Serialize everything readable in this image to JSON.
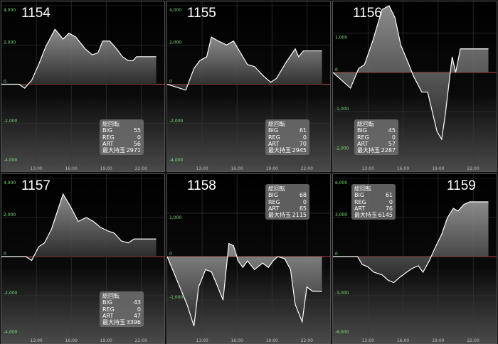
{
  "colors": {
    "line": "#ffffff",
    "zero_line": "#c23b3b",
    "grid": "#3a3a3a",
    "ytick": "#7be07b",
    "xtick": "#bbbbbb"
  },
  "stats_labels": {
    "title": "総回転",
    "big": "BIG",
    "reg": "REG",
    "art": "ART",
    "max": "最大持玉"
  },
  "chart_data": [
    {
      "type": "area",
      "machine": "1154",
      "yticks": [
        4000,
        2000,
        0,
        -2000,
        -4000
      ],
      "ytick_labels": [
        "4,000",
        "2,000",
        "0",
        "-2,000",
        "-4,000"
      ],
      "ylim": [
        -4000,
        4000
      ],
      "xlim": [
        10,
        24
      ],
      "xticks": [
        13,
        16,
        19,
        22
      ],
      "xtick_labels": [
        "13:00",
        "16:00",
        "19:00",
        "22:00"
      ],
      "stats": {
        "big": "55",
        "reg": "0",
        "art": "56",
        "max": "2971"
      },
      "x": [
        10,
        11.5,
        12,
        12.6,
        13.2,
        13.8,
        14.6,
        15.3,
        15.8,
        16.4,
        17.2,
        17.8,
        18.3,
        18.7,
        19.3,
        19.9,
        20.4,
        20.9,
        21.3,
        21.6,
        22.5,
        23.3
      ],
      "y": [
        0,
        0,
        -200,
        200,
        1000,
        1900,
        2800,
        2300,
        2600,
        2400,
        1800,
        1500,
        1600,
        2200,
        2200,
        1800,
        1400,
        1200,
        1200,
        1400,
        1400,
        1400
      ]
    },
    {
      "type": "area",
      "machine": "1155",
      "yticks": [
        4000,
        2000,
        0,
        -2000,
        -4000
      ],
      "ytick_labels": [
        "4,000",
        "2,000",
        "0",
        "-2,000",
        "-4,000"
      ],
      "ylim": [
        -4000,
        4000
      ],
      "xlim": [
        10,
        24
      ],
      "xticks": [
        13,
        16,
        19,
        22
      ],
      "xtick_labels": [
        "13:00",
        "16:00",
        "19:00",
        "22:00"
      ],
      "stats": {
        "big": "61",
        "reg": "0",
        "art": "70",
        "max": "2945"
      },
      "x": [
        10,
        11.6,
        12.3,
        12.8,
        13.4,
        13.8,
        14.4,
        15.1,
        15.7,
        16.4,
        16.9,
        17.5,
        18.3,
        18.9,
        19.4,
        20.2,
        21,
        21.3,
        21.7,
        22.4,
        23.3
      ],
      "y": [
        0,
        -300,
        800,
        1200,
        1400,
        2400,
        2200,
        2000,
        2200,
        1500,
        1000,
        900,
        400,
        100,
        300,
        1100,
        1800,
        1400,
        1700,
        1700,
        1700
      ]
    },
    {
      "type": "area",
      "machine": "1156",
      "yticks": [
        1000,
        0,
        -1000,
        -2000
      ],
      "ytick_labels": [
        "1,000",
        "0",
        "-1,000",
        "-2,000"
      ],
      "ylim": [
        -2300,
        1700
      ],
      "xlim": [
        10,
        24
      ],
      "xticks": [
        13,
        16,
        19,
        22
      ],
      "xtick_labels": [
        "13:00",
        "16:00",
        "19:00",
        "22:00"
      ],
      "stats": {
        "big": "45",
        "reg": "0",
        "art": "57",
        "max": "2287"
      },
      "x": [
        10,
        11.5,
        12.2,
        12.7,
        13.4,
        13.9,
        14.2,
        14.8,
        15.3,
        15.8,
        16.5,
        16.9,
        17.6,
        18.1,
        18.5,
        18.9,
        19.3,
        19.6,
        20.2,
        20.5,
        20.9,
        21.5,
        22.3,
        23.3
      ],
      "y": [
        0,
        -400,
        100,
        200,
        800,
        1300,
        1600,
        1700,
        1400,
        700,
        200,
        -100,
        -500,
        -500,
        -1000,
        -1500,
        -1700,
        -1100,
        400,
        0,
        600,
        600,
        600,
        600
      ]
    },
    {
      "type": "area",
      "machine": "1157",
      "yticks": [
        4000,
        2000,
        0,
        -2000,
        -4000
      ],
      "ytick_labels": [
        "4,000",
        "2,000",
        "0",
        "-2,000",
        "-4,000"
      ],
      "ylim": [
        -4000,
        4000
      ],
      "xlim": [
        10,
        24
      ],
      "xticks": [
        13,
        16,
        19,
        22
      ],
      "xtick_labels": [
        "13:00",
        "16:00",
        "19:00",
        "22:00"
      ],
      "stats": {
        "big": "43",
        "reg": "0",
        "art": "47",
        "max": "3396"
      },
      "x": [
        10,
        11.6,
        12.1,
        12.6,
        13.2,
        13.7,
        14.3,
        14.8,
        15.3,
        15.9,
        16.6,
        17.3,
        17.9,
        18.5,
        19.2,
        19.7,
        20.3,
        20.9,
        21.4,
        21.8,
        22.5,
        23.3
      ],
      "y": [
        0,
        0,
        0,
        -200,
        500,
        700,
        1400,
        2300,
        3200,
        2600,
        1800,
        2000,
        1800,
        1500,
        1300,
        1200,
        800,
        700,
        900,
        900,
        900,
        900
      ]
    },
    {
      "type": "area",
      "machine": "1158",
      "yticks": [
        1000,
        0,
        -1000
      ],
      "ytick_labels": [
        "1,000",
        "0",
        "-1,000"
      ],
      "ylim": [
        -1800,
        1800
      ],
      "xlim": [
        10,
        24
      ],
      "xticks": [
        13,
        16,
        19,
        22
      ],
      "xtick_labels": [
        "13:00",
        "16:00",
        "19:00",
        "22:00"
      ],
      "stats": {
        "big": "68",
        "reg": "0",
        "art": "65",
        "max": "2115"
      },
      "x": [
        10,
        11.7,
        12.3,
        12.7,
        13.3,
        13.8,
        14.2,
        14.8,
        15.3,
        15.7,
        16.1,
        16.5,
        16.9,
        17.5,
        18.2,
        18.7,
        19.1,
        19.5,
        20.1,
        20.6,
        21,
        21.6,
        22,
        22.5,
        23.3
      ],
      "y": [
        0,
        -1100,
        -1600,
        -700,
        -300,
        -350,
        -600,
        -1000,
        300,
        250,
        -100,
        -250,
        -100,
        -300,
        -150,
        -250,
        -100,
        0,
        -50,
        -300,
        -1100,
        -1500,
        -700,
        -800,
        -800
      ]
    },
    {
      "type": "area",
      "machine": "1159",
      "yticks": [
        6000,
        3000,
        0,
        -3000,
        -6000
      ],
      "ytick_labels": [
        "6,000",
        "3,000",
        "0",
        "-3,000",
        "-6,000"
      ],
      "ylim": [
        -6000,
        6000
      ],
      "xlim": [
        10,
        24
      ],
      "xticks": [
        13,
        16,
        19,
        22
      ],
      "xtick_labels": [
        "13:00",
        "16:00",
        "19:00",
        "22:00"
      ],
      "stats": {
        "big": "61",
        "reg": "0",
        "art": "76",
        "max": "6145"
      },
      "x": [
        10,
        11.6,
        12.1,
        12.5,
        13,
        13.5,
        14.2,
        14.7,
        15.2,
        15.7,
        16.3,
        16.8,
        17.3,
        17.7,
        18.2,
        18.8,
        19.3,
        19.8,
        20.3,
        20.7,
        21.2,
        21.7,
        22.3,
        23.3
      ],
      "y": [
        0,
        0,
        0,
        -600,
        -800,
        -1200,
        -1400,
        -1800,
        -2000,
        -1600,
        -1200,
        -900,
        -700,
        -1200,
        -400,
        800,
        1700,
        3000,
        3700,
        3500,
        4000,
        4200,
        4200,
        4200
      ]
    }
  ]
}
